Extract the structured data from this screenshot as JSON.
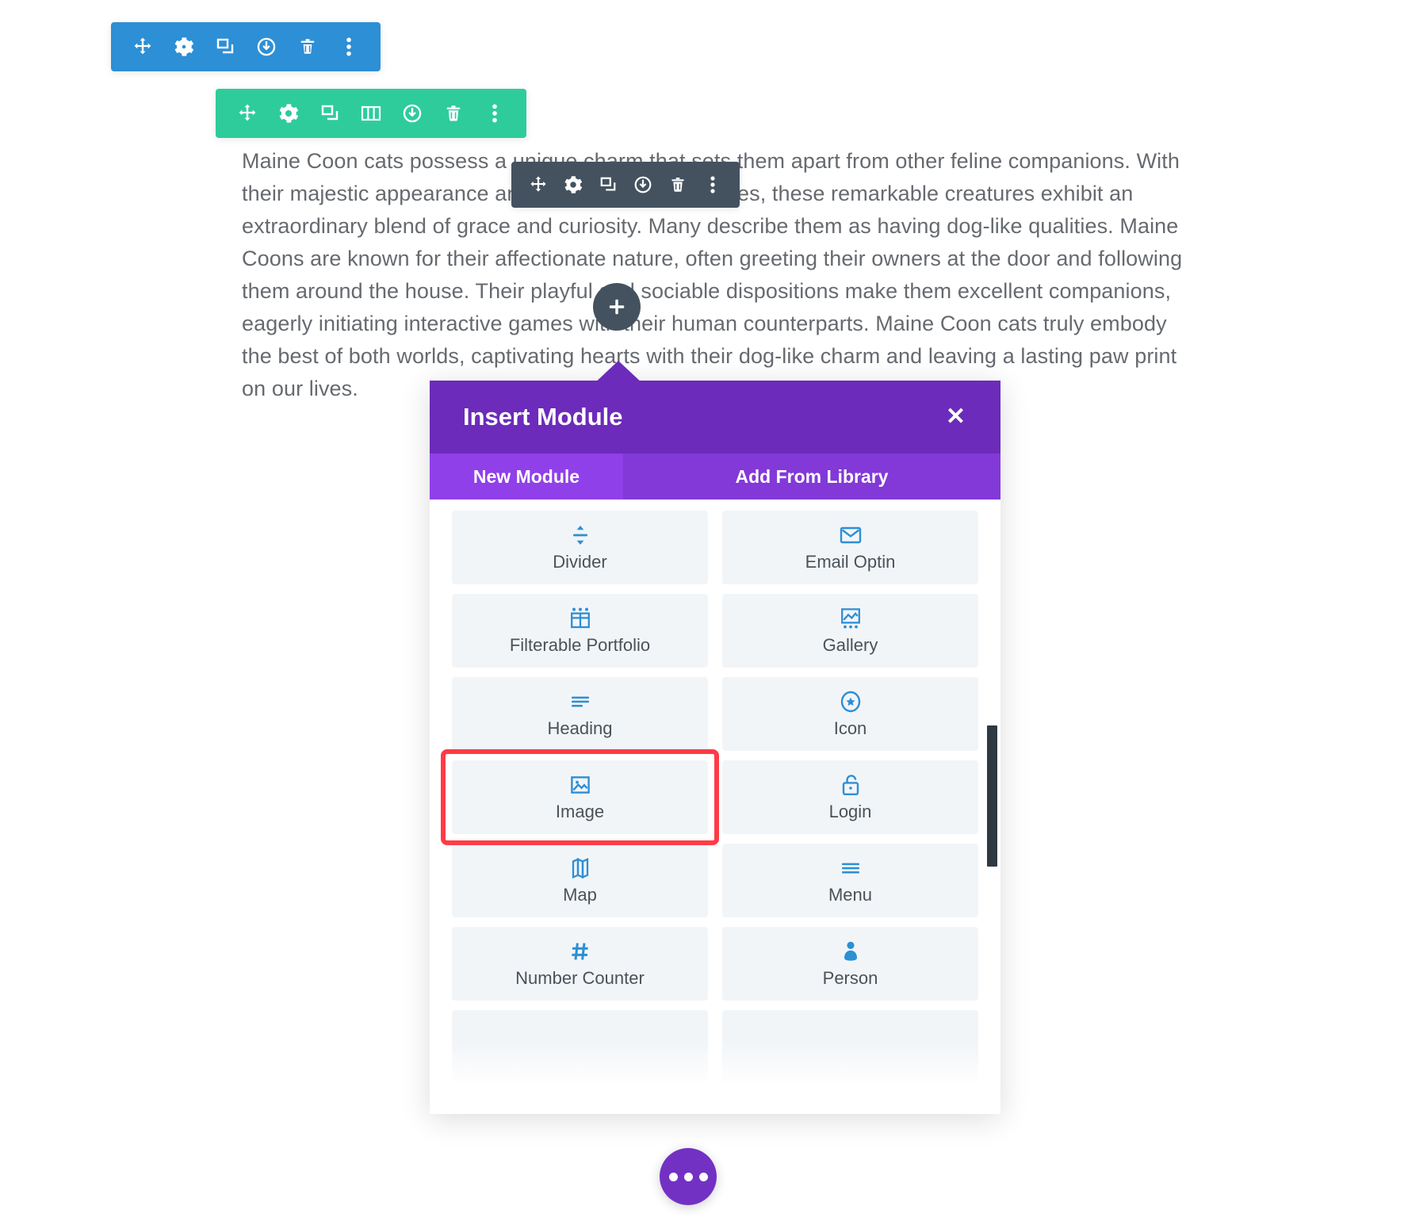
{
  "page": {
    "body_text": "Maine Coon cats possess a unique charm that sets them apart from other feline companions. With their majestic appearance and endearing personalities, these remarkable creatures exhibit an extraordinary blend of grace and curiosity. Many describe them as having dog-like qualities. Maine Coons are known for their affectionate nature, often greeting their owners at the door and following them around the house. Their playful and sociable dispositions make them excellent companions, eagerly initiating interactive games with their human counterparts. Maine Coon cats truly embody the best of both worlds, captivating hearts with their dog-like charm and leaving a lasting paw print on our lives."
  },
  "toolbars": {
    "section": {
      "color": "#2d8fd5",
      "buttons": [
        {
          "name": "move-icon",
          "label": "Move Section"
        },
        {
          "name": "gear-icon",
          "label": "Section Settings"
        },
        {
          "name": "duplicate-icon",
          "label": "Duplicate Section"
        },
        {
          "name": "save-to-library-icon",
          "label": "Save Section To Library"
        },
        {
          "name": "trash-icon",
          "label": "Delete Section"
        },
        {
          "name": "vertical-dots-icon",
          "label": "More Options"
        }
      ]
    },
    "row": {
      "color": "#2ecc9b",
      "buttons": [
        {
          "name": "move-icon",
          "label": "Move Row"
        },
        {
          "name": "gear-icon",
          "label": "Row Settings"
        },
        {
          "name": "duplicate-icon",
          "label": "Duplicate Row"
        },
        {
          "name": "columns-icon",
          "label": "Change Column Structure"
        },
        {
          "name": "save-to-library-icon",
          "label": "Save Row To Library"
        },
        {
          "name": "trash-icon",
          "label": "Delete Row"
        },
        {
          "name": "vertical-dots-icon",
          "label": "More Options"
        }
      ]
    },
    "module": {
      "color": "#44525f",
      "buttons": [
        {
          "name": "move-icon",
          "label": "Move Module"
        },
        {
          "name": "gear-icon",
          "label": "Module Settings"
        },
        {
          "name": "duplicate-icon",
          "label": "Duplicate Module"
        },
        {
          "name": "save-to-library-icon",
          "label": "Save Module To Library"
        },
        {
          "name": "trash-icon",
          "label": "Delete Module"
        },
        {
          "name": "vertical-dots-icon",
          "label": "More Options"
        }
      ]
    }
  },
  "add_module_button": {
    "icon": "plus-icon",
    "label": "+"
  },
  "modal": {
    "title": "Insert Module",
    "close_label": "✕",
    "accent_color": "#6c2bba",
    "tabs": [
      {
        "label": "New Module",
        "active": true
      },
      {
        "label": "Add From Library",
        "active": false
      }
    ],
    "modules": [
      {
        "label": "Divider",
        "icon": "divider-icon"
      },
      {
        "label": "Email Optin",
        "icon": "envelope-icon"
      },
      {
        "label": "Filterable Portfolio",
        "icon": "grid-table-icon"
      },
      {
        "label": "Gallery",
        "icon": "gallery-icon"
      },
      {
        "label": "Heading",
        "icon": "heading-lines-icon"
      },
      {
        "label": "Icon",
        "icon": "star-circle-icon"
      },
      {
        "label": "Image",
        "icon": "image-icon"
      },
      {
        "label": "Login",
        "icon": "unlock-icon"
      },
      {
        "label": "Map",
        "icon": "map-icon"
      },
      {
        "label": "Menu",
        "icon": "menu-lines-icon"
      },
      {
        "label": "Number Counter",
        "icon": "hash-icon"
      },
      {
        "label": "Person",
        "icon": "person-icon"
      }
    ],
    "highlighted_module": "Image",
    "highlight_color": "#ff3b46"
  },
  "fab": {
    "name": "more-options-fab",
    "label": "•••",
    "color": "#7331c4"
  }
}
